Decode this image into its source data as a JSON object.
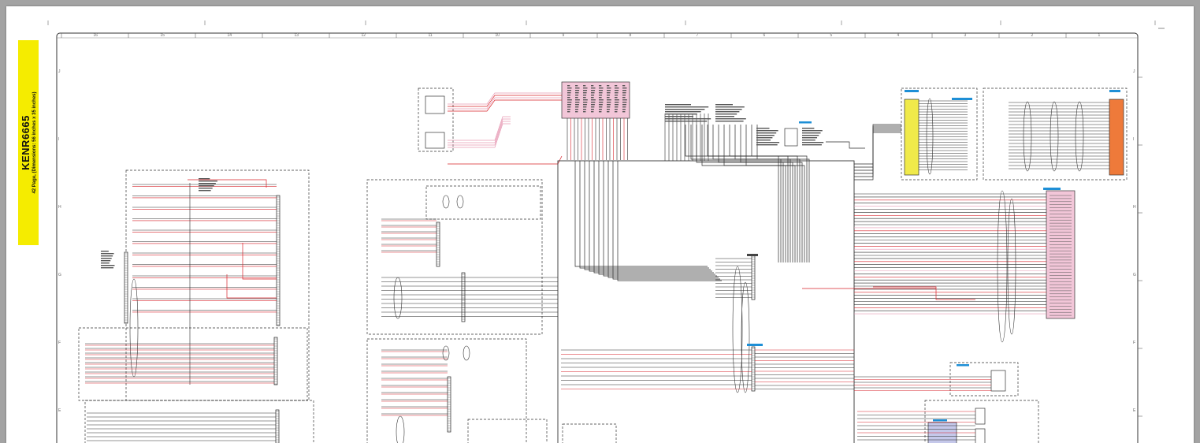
{
  "document": {
    "title": "KENR6665",
    "subtitle": "42 Page, (Dimensions: 56 inches x 35 inches)"
  },
  "colors": {
    "background": "#a3a3a3",
    "sheet": "#ffffff",
    "title_strip": "#f5ec00",
    "wire_black": "#2b2b2b",
    "wire_red": "#d8232a",
    "wire_pink": "#e79ab4",
    "component_pink": "#f2c6d8",
    "component_yellow": "#f0ea4a",
    "component_orange": "#ee7a3a",
    "component_blue": "#1e8fd6"
  },
  "sheet": {
    "column_zones": [
      "16",
      "15",
      "14",
      "13",
      "12",
      "11",
      "10",
      "9",
      "8",
      "7",
      "6",
      "5",
      "4",
      "3",
      "2",
      "1"
    ],
    "row_zones": [
      "J",
      "I",
      "H",
      "G",
      "F",
      "E"
    ]
  },
  "icons": [
    "zoom-marker-icon"
  ]
}
